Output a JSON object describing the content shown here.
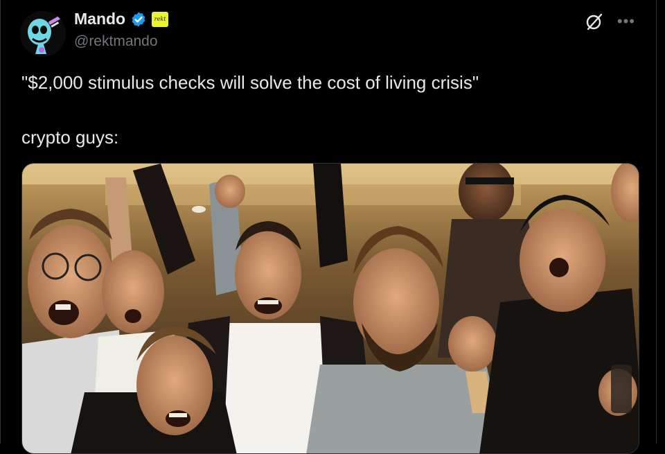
{
  "author": {
    "name": "Mando",
    "handle": "@rektmando",
    "org_badge_text": "rekt",
    "verified_color": "#1d9bf0",
    "avatar_icon": "skull-mascot-avatar"
  },
  "actions": {
    "grok_icon": "grok-icon",
    "more_icon": "more-horizontal-icon"
  },
  "tweet": {
    "line1": "\"$2,000 stimulus checks will solve the cost of living crisis\"",
    "line2": "crypto guys:"
  },
  "media": {
    "description_icon": "photo-meme-crowd-cheering"
  }
}
